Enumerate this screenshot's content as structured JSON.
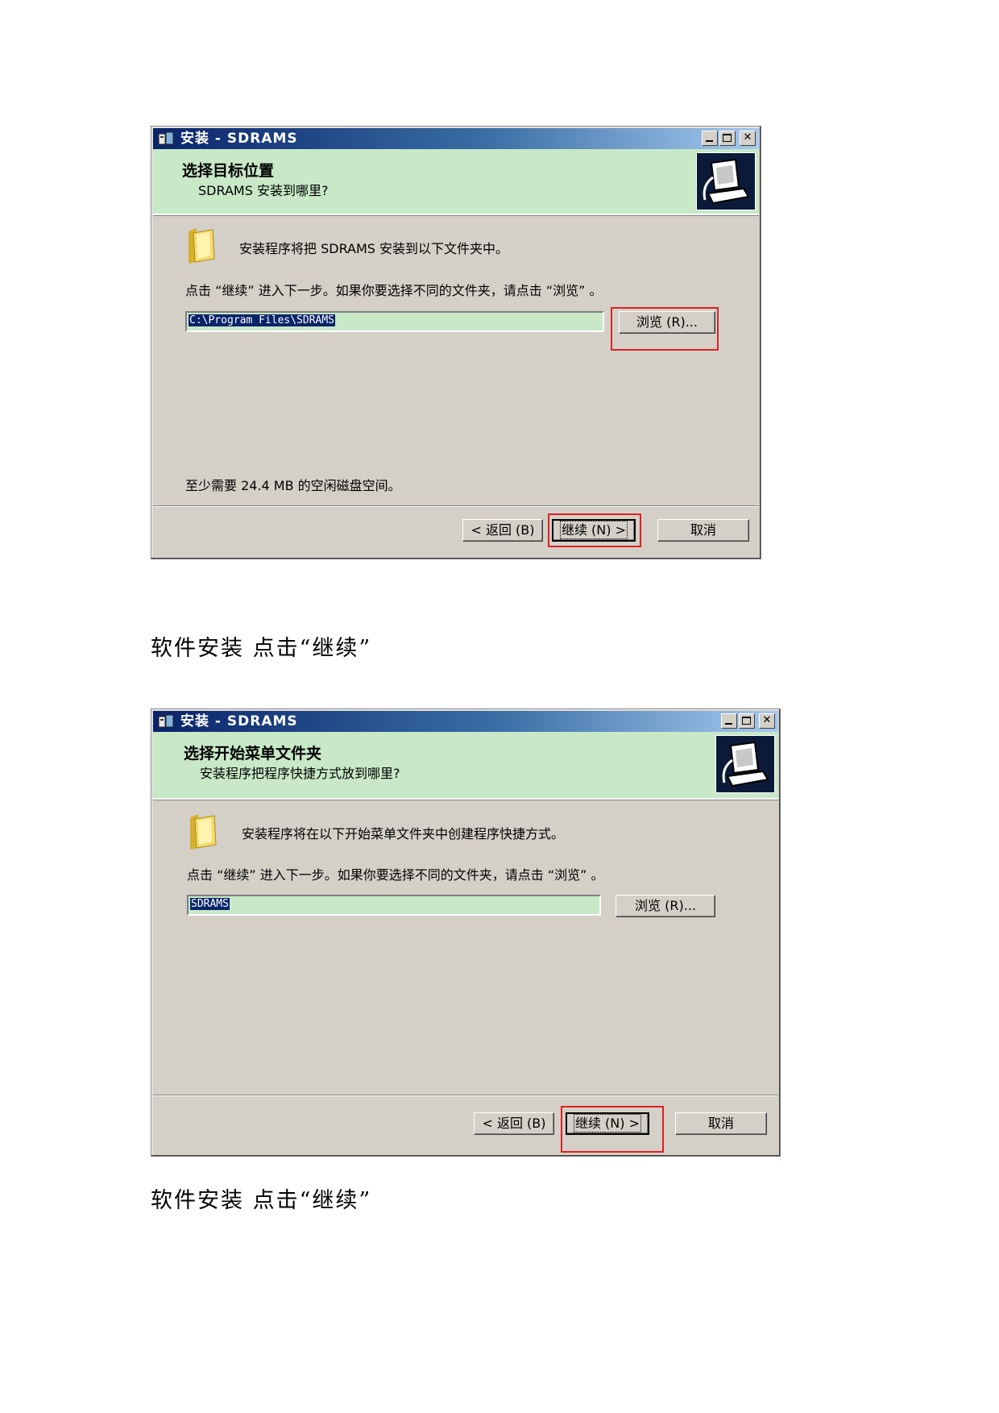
{
  "dialogs": [
    {
      "title": "安装 - SDRAMS",
      "header_title": "选择目标位置",
      "header_subtitle": "SDRAMS 安装到哪里?",
      "info_text": "安装程序将把 SDRAMS 安装到以下文件夹中。",
      "instruction_text": "点击 “继续” 进入下一步。如果你要选择不同的文件夹，请点击 “浏览” 。",
      "path_value": "C:\\Program Files\\SDRAMS",
      "browse_label": "浏览 (R)...",
      "space_text": "至少需要 24.4 MB 的空闲磁盘空间。",
      "back_label": "< 返回 (B)",
      "next_label": "继续 (N) >",
      "cancel_label": "取消"
    },
    {
      "title": "安装 - SDRAMS",
      "header_title": "选择开始菜单文件夹",
      "header_subtitle": "安装程序把程序快捷方式放到哪里?",
      "info_text": "安装程序将在以下开始菜单文件夹中创建程序快捷方式。",
      "instruction_text": "点击 “继续” 进入下一步。如果你要选择不同的文件夹，请点击 “浏览” 。",
      "path_value": "SDRAMS",
      "browse_label": "浏览 (R)...",
      "back_label": "< 返回 (B)",
      "next_label": "继续 (N) >",
      "cancel_label": "取消"
    }
  ],
  "captions": [
    "软件安装  点击“继续”",
    "软件安装  点击“继续”"
  ],
  "colors": {
    "title_gradient_start": "#0a246a",
    "header_green": "#c8e8c8",
    "dialog_gray": "#d4d0c8",
    "highlight_red": "#e02020"
  }
}
